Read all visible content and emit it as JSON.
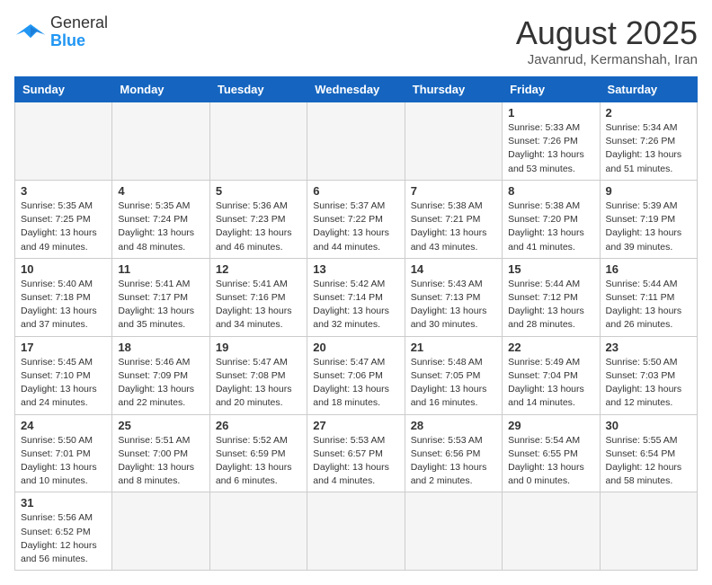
{
  "header": {
    "logo_general": "General",
    "logo_blue": "Blue",
    "month_year": "August 2025",
    "location": "Javanrud, Kermanshah, Iran"
  },
  "weekdays": [
    "Sunday",
    "Monday",
    "Tuesday",
    "Wednesday",
    "Thursday",
    "Friday",
    "Saturday"
  ],
  "rows": [
    [
      {
        "day": "",
        "info": ""
      },
      {
        "day": "",
        "info": ""
      },
      {
        "day": "",
        "info": ""
      },
      {
        "day": "",
        "info": ""
      },
      {
        "day": "",
        "info": ""
      },
      {
        "day": "1",
        "info": "Sunrise: 5:33 AM\nSunset: 7:26 PM\nDaylight: 13 hours\nand 53 minutes."
      },
      {
        "day": "2",
        "info": "Sunrise: 5:34 AM\nSunset: 7:26 PM\nDaylight: 13 hours\nand 51 minutes."
      }
    ],
    [
      {
        "day": "3",
        "info": "Sunrise: 5:35 AM\nSunset: 7:25 PM\nDaylight: 13 hours\nand 49 minutes."
      },
      {
        "day": "4",
        "info": "Sunrise: 5:35 AM\nSunset: 7:24 PM\nDaylight: 13 hours\nand 48 minutes."
      },
      {
        "day": "5",
        "info": "Sunrise: 5:36 AM\nSunset: 7:23 PM\nDaylight: 13 hours\nand 46 minutes."
      },
      {
        "day": "6",
        "info": "Sunrise: 5:37 AM\nSunset: 7:22 PM\nDaylight: 13 hours\nand 44 minutes."
      },
      {
        "day": "7",
        "info": "Sunrise: 5:38 AM\nSunset: 7:21 PM\nDaylight: 13 hours\nand 43 minutes."
      },
      {
        "day": "8",
        "info": "Sunrise: 5:38 AM\nSunset: 7:20 PM\nDaylight: 13 hours\nand 41 minutes."
      },
      {
        "day": "9",
        "info": "Sunrise: 5:39 AM\nSunset: 7:19 PM\nDaylight: 13 hours\nand 39 minutes."
      }
    ],
    [
      {
        "day": "10",
        "info": "Sunrise: 5:40 AM\nSunset: 7:18 PM\nDaylight: 13 hours\nand 37 minutes."
      },
      {
        "day": "11",
        "info": "Sunrise: 5:41 AM\nSunset: 7:17 PM\nDaylight: 13 hours\nand 35 minutes."
      },
      {
        "day": "12",
        "info": "Sunrise: 5:41 AM\nSunset: 7:16 PM\nDaylight: 13 hours\nand 34 minutes."
      },
      {
        "day": "13",
        "info": "Sunrise: 5:42 AM\nSunset: 7:14 PM\nDaylight: 13 hours\nand 32 minutes."
      },
      {
        "day": "14",
        "info": "Sunrise: 5:43 AM\nSunset: 7:13 PM\nDaylight: 13 hours\nand 30 minutes."
      },
      {
        "day": "15",
        "info": "Sunrise: 5:44 AM\nSunset: 7:12 PM\nDaylight: 13 hours\nand 28 minutes."
      },
      {
        "day": "16",
        "info": "Sunrise: 5:44 AM\nSunset: 7:11 PM\nDaylight: 13 hours\nand 26 minutes."
      }
    ],
    [
      {
        "day": "17",
        "info": "Sunrise: 5:45 AM\nSunset: 7:10 PM\nDaylight: 13 hours\nand 24 minutes."
      },
      {
        "day": "18",
        "info": "Sunrise: 5:46 AM\nSunset: 7:09 PM\nDaylight: 13 hours\nand 22 minutes."
      },
      {
        "day": "19",
        "info": "Sunrise: 5:47 AM\nSunset: 7:08 PM\nDaylight: 13 hours\nand 20 minutes."
      },
      {
        "day": "20",
        "info": "Sunrise: 5:47 AM\nSunset: 7:06 PM\nDaylight: 13 hours\nand 18 minutes."
      },
      {
        "day": "21",
        "info": "Sunrise: 5:48 AM\nSunset: 7:05 PM\nDaylight: 13 hours\nand 16 minutes."
      },
      {
        "day": "22",
        "info": "Sunrise: 5:49 AM\nSunset: 7:04 PM\nDaylight: 13 hours\nand 14 minutes."
      },
      {
        "day": "23",
        "info": "Sunrise: 5:50 AM\nSunset: 7:03 PM\nDaylight: 13 hours\nand 12 minutes."
      }
    ],
    [
      {
        "day": "24",
        "info": "Sunrise: 5:50 AM\nSunset: 7:01 PM\nDaylight: 13 hours\nand 10 minutes."
      },
      {
        "day": "25",
        "info": "Sunrise: 5:51 AM\nSunset: 7:00 PM\nDaylight: 13 hours\nand 8 minutes."
      },
      {
        "day": "26",
        "info": "Sunrise: 5:52 AM\nSunset: 6:59 PM\nDaylight: 13 hours\nand 6 minutes."
      },
      {
        "day": "27",
        "info": "Sunrise: 5:53 AM\nSunset: 6:57 PM\nDaylight: 13 hours\nand 4 minutes."
      },
      {
        "day": "28",
        "info": "Sunrise: 5:53 AM\nSunset: 6:56 PM\nDaylight: 13 hours\nand 2 minutes."
      },
      {
        "day": "29",
        "info": "Sunrise: 5:54 AM\nSunset: 6:55 PM\nDaylight: 13 hours\nand 0 minutes."
      },
      {
        "day": "30",
        "info": "Sunrise: 5:55 AM\nSunset: 6:54 PM\nDaylight: 12 hours\nand 58 minutes."
      }
    ],
    [
      {
        "day": "31",
        "info": "Sunrise: 5:56 AM\nSunset: 6:52 PM\nDaylight: 12 hours\nand 56 minutes."
      },
      {
        "day": "",
        "info": ""
      },
      {
        "day": "",
        "info": ""
      },
      {
        "day": "",
        "info": ""
      },
      {
        "day": "",
        "info": ""
      },
      {
        "day": "",
        "info": ""
      },
      {
        "day": "",
        "info": ""
      }
    ]
  ]
}
